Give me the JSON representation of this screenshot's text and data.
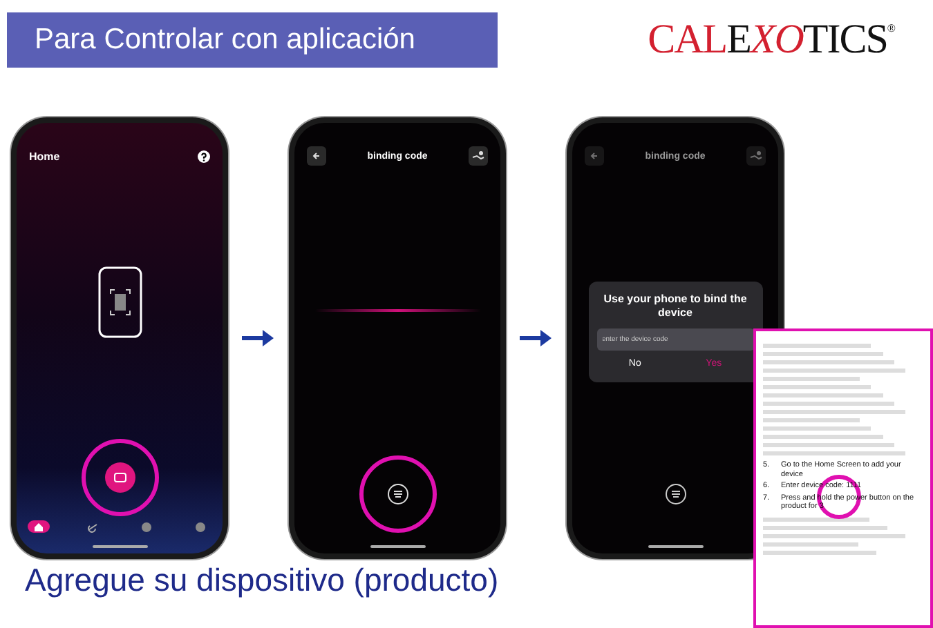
{
  "banner": {
    "title": "Para Controlar con aplicación"
  },
  "logo": {
    "parts": [
      {
        "text": "CAL",
        "color": "#d3202f"
      },
      {
        "text": "E",
        "color": "#111111"
      },
      {
        "text": "XO",
        "color": "#d3202f"
      },
      {
        "text": "TICS",
        "color": "#111111"
      }
    ],
    "mark": "®"
  },
  "screens": [
    {
      "kind": "home",
      "title": "Home",
      "tabs": [
        {
          "selected": true
        },
        {
          "selected": false
        },
        {
          "selected": false
        },
        {
          "selected": false
        }
      ]
    },
    {
      "kind": "binding",
      "title": "binding code"
    },
    {
      "kind": "dialog",
      "title": "binding code",
      "dialog": {
        "title": "Use your phone to bind the device",
        "placeholder": "enter the device code",
        "buttons": [
          "No",
          "Yes"
        ]
      }
    }
  ],
  "manual": {
    "steps": [
      {
        "number": "5.",
        "text": "Go to the Home Screen to add your device"
      },
      {
        "number": "6.",
        "text": "Enter device code: 1111"
      },
      {
        "number": "7.",
        "text": "Press and hold the power button on the product for 3"
      }
    ]
  },
  "caption": "Agregue su dispositivo (producto)"
}
